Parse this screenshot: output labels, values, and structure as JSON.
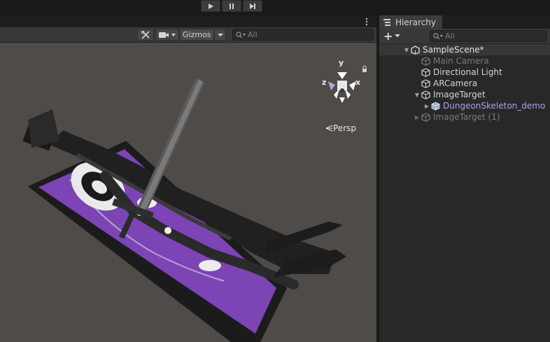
{
  "playbar": {
    "play_icon": "play-icon",
    "pause_icon": "pause-icon",
    "step_icon": "step-icon"
  },
  "scene": {
    "tools_icon": "tools-icon",
    "camera_icon": "camera-icon",
    "gizmos_label": "Gizmos",
    "search_placeholder": "All",
    "persp_label": "Persp",
    "axis_x": "x",
    "axis_y": "y",
    "axis_z": "z",
    "lock_icon": "lock-icon"
  },
  "hierarchy": {
    "tab_label": "Hierarchy",
    "add_label": "+",
    "search_placeholder": "All",
    "scene_name": "SampleScene*",
    "items": [
      {
        "label": "Main Camera",
        "state": "inactive"
      },
      {
        "label": "Directional Light",
        "state": "normal"
      },
      {
        "label": "ARCamera",
        "state": "normal"
      },
      {
        "label": "ImageTarget",
        "state": "normal"
      },
      {
        "label": "DungeonSkeleton_demo",
        "state": "prefab"
      },
      {
        "label": "ImageTarget (1)",
        "state": "inactive"
      }
    ]
  },
  "colors": {
    "accent_purple": "#8d5bd4",
    "prefab_text": "#b59ce8",
    "inactive_text": "#7a7a7a",
    "scene_bg": "#4e4b48",
    "target_purple": "#7c44b5"
  }
}
